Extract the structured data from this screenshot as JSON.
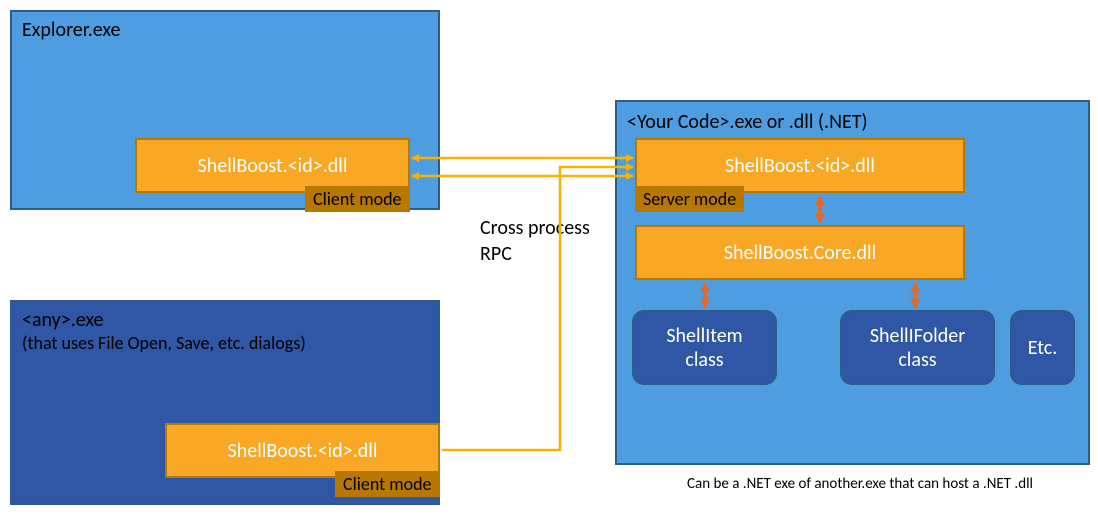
{
  "explorer": {
    "title": "Explorer.exe"
  },
  "anyexe": {
    "title": "<any>.exe",
    "subtitle": "(that uses File Open, Save, etc. dialogs)"
  },
  "yourcode": {
    "title": "<Your Code>.exe or .dll (.NET)"
  },
  "clientDll1": {
    "label": "ShellBoost.<id>.dll",
    "mode": "Client mode"
  },
  "clientDll2": {
    "label": "ShellBoost.<id>.dll",
    "mode": "Client mode"
  },
  "serverDll": {
    "label": "ShellBoost.<id>.dll",
    "mode": "Server mode"
  },
  "coreDll": {
    "label": "ShellBoost.Core.dll"
  },
  "classes": {
    "shellItem": "ShellItem\nclass",
    "shellFolder": "ShellIFolder\nclass",
    "etc": "Etc."
  },
  "rpcLabel": "Cross process\nRPC",
  "footnote": "Can be a .NET exe of another.exe that can host a .NET .dll",
  "colors": {
    "lightBlue": "#4d9de0",
    "darkBlue": "#3056a6",
    "orange": "#f9a825",
    "darkOrange": "#b87800",
    "arrowYellow": "#f5b400",
    "arrowOrange": "#e06a2a"
  }
}
